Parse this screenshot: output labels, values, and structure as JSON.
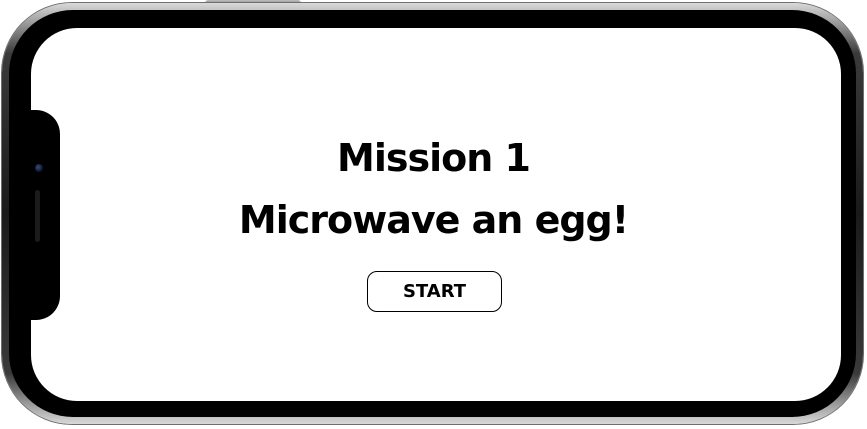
{
  "mission": {
    "title": "Mission 1",
    "subtitle": "Microwave an egg!",
    "start_label": "START"
  },
  "colors": {
    "screen_background": "#ffffff",
    "text": "#000000",
    "frame": "#1a1a1a"
  }
}
